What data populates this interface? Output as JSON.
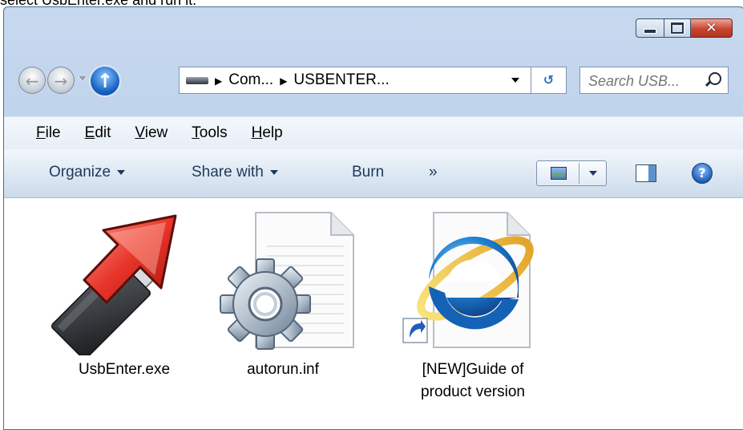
{
  "instruction_caption": "select UsbEnter.exe and run it.",
  "window": {
    "caption_buttons": {
      "minimize": "minimize",
      "maximize": "maximize",
      "close": "close"
    }
  },
  "nav": {
    "back_icon": "back-arrow-icon",
    "forward_icon": "forward-arrow-icon",
    "up_icon": "up-arrow-icon",
    "breadcrumb": [
      "Com...",
      "USBENTER..."
    ],
    "search_placeholder": "Search USB..."
  },
  "menu": [
    "File",
    "Edit",
    "View",
    "Tools",
    "Help"
  ],
  "menu_mnemonics": [
    "F",
    "E",
    "V",
    "T",
    "H"
  ],
  "commands": {
    "organize": "Organize",
    "share_with": "Share with",
    "burn": "Burn",
    "more": "»"
  },
  "files": [
    {
      "name": "UsbEnter.exe",
      "icon": "usb-drive-icon"
    },
    {
      "name": "autorun.inf",
      "icon": "settings-file-icon"
    },
    {
      "name": "[NEW]Guide of product version",
      "icon": "internet-explorer-shortcut-icon",
      "label_lines": [
        "[NEW]Guide of",
        "product version"
      ]
    }
  ],
  "colors": {
    "accent_arrow": "#d62a1f",
    "window_frame": "#bcd1ea"
  }
}
